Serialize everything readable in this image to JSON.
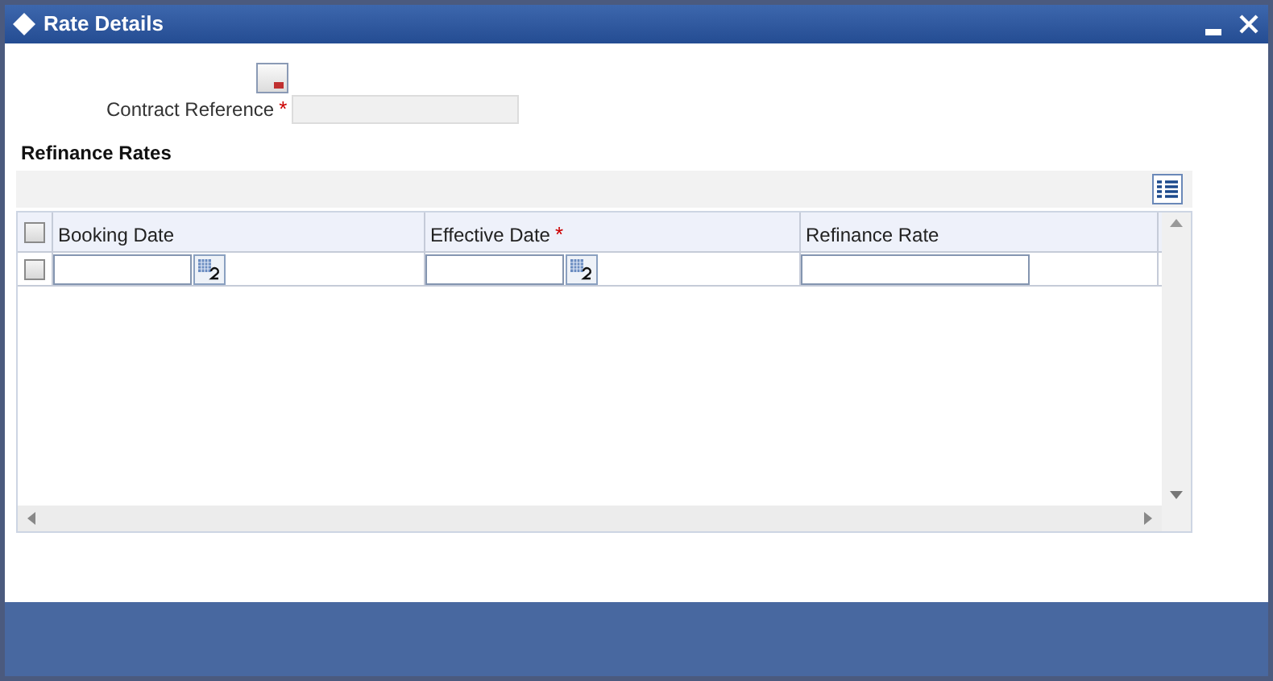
{
  "window": {
    "title": "Rate Details"
  },
  "contract_reference": {
    "label": "Contract Reference",
    "required_mark": "*"
  },
  "section": {
    "title": "Refinance Rates"
  },
  "table": {
    "all_checked": false,
    "columns": [
      {
        "label": "Booking Date",
        "kind": "date"
      },
      {
        "label": "Effective Date",
        "required_mark": "*",
        "kind": "date"
      },
      {
        "label": "Refinance Rate",
        "kind": "text"
      }
    ],
    "rows": [
      {
        "checked": false
      }
    ]
  }
}
